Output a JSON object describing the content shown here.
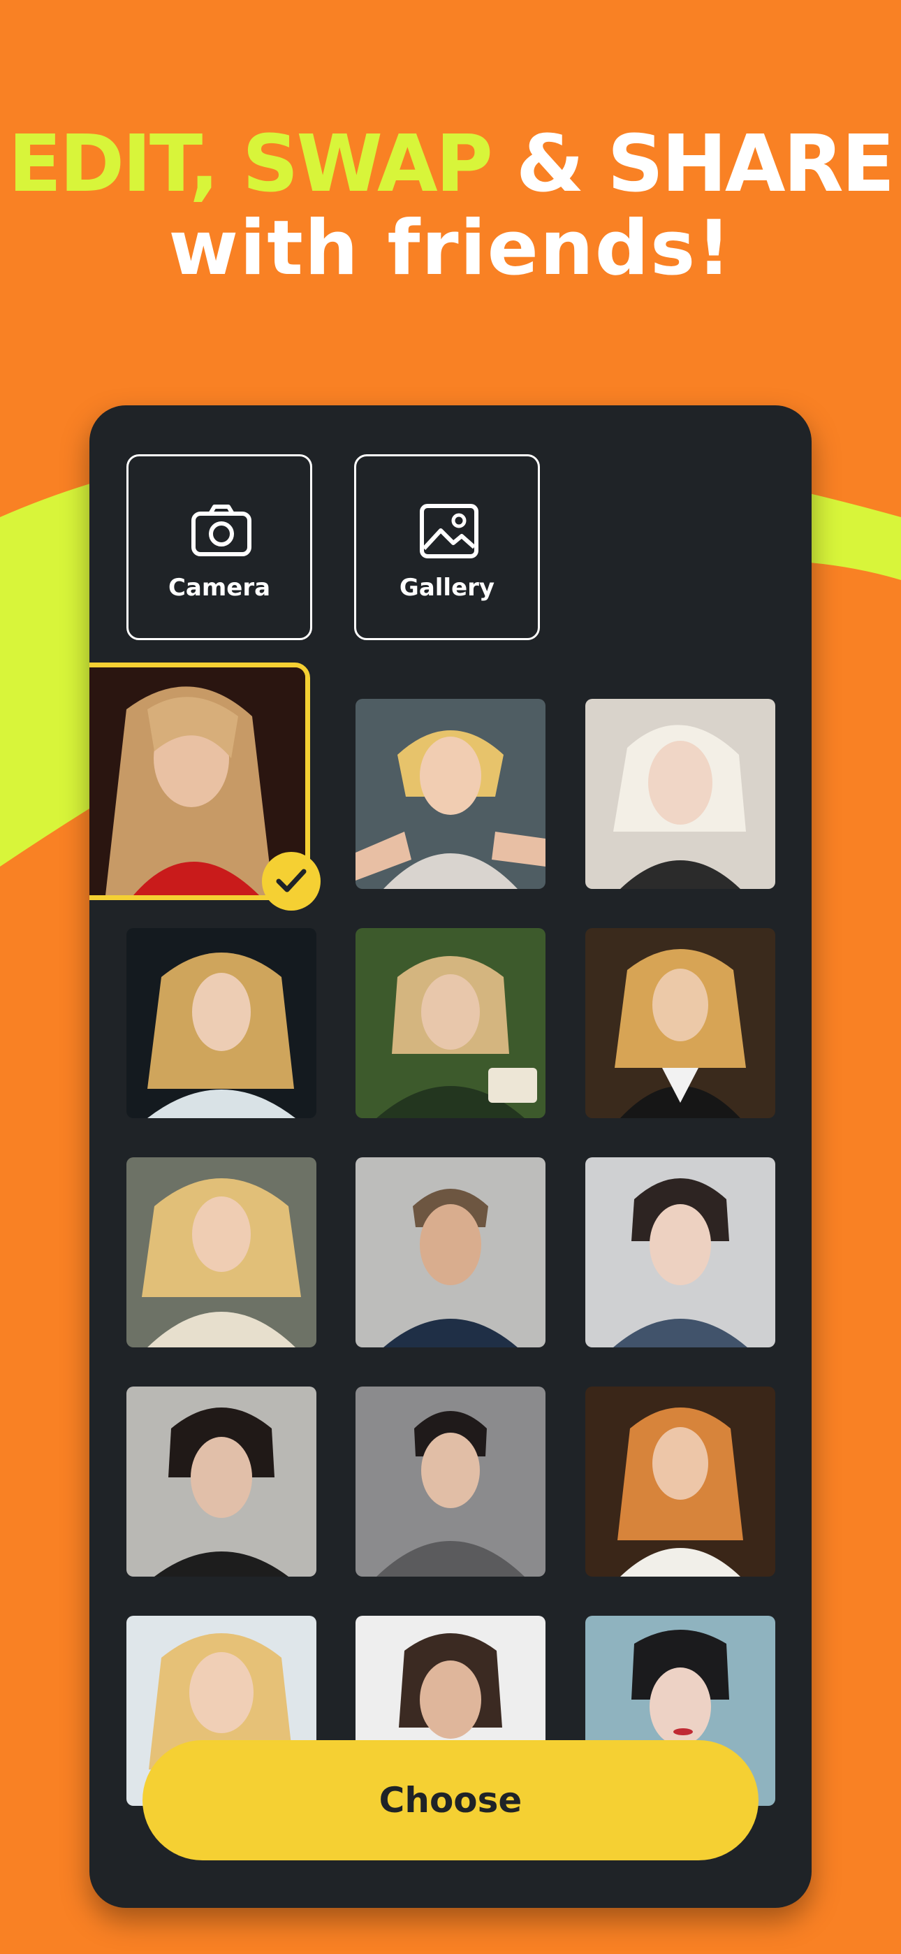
{
  "headline": {
    "part1": "EDIT, SWAP",
    "part2": " & SHARE",
    "line2": "with friends!"
  },
  "colors": {
    "background": "#f98124",
    "accent_lime": "#d8f53a",
    "panel": "#1f2327",
    "accent_yellow": "#f5d033"
  },
  "sources": [
    {
      "label": "Camera",
      "icon": "camera-icon"
    },
    {
      "label": "Gallery",
      "icon": "image-icon"
    }
  ],
  "photos": [
    {
      "id": "portrait-blonde-long-red-top",
      "selected": true
    },
    {
      "id": "portrait-anime-blonde-short",
      "selected": false
    },
    {
      "id": "portrait-platinum-bob",
      "selected": false
    },
    {
      "id": "portrait-blonde-curly",
      "selected": false
    },
    {
      "id": "portrait-blonde-reading",
      "selected": false
    },
    {
      "id": "portrait-blonde-uniform",
      "selected": false
    },
    {
      "id": "portrait-blonde-coat",
      "selected": false
    },
    {
      "id": "portrait-man-navy",
      "selected": false
    },
    {
      "id": "portrait-boy-dark-hair",
      "selected": false
    },
    {
      "id": "portrait-man-black-hair",
      "selected": false
    },
    {
      "id": "portrait-boy-hoodie",
      "selected": false
    },
    {
      "id": "portrait-redhead-uniform",
      "selected": false
    },
    {
      "id": "portrait-smiling-blonde",
      "selected": false
    },
    {
      "id": "portrait-young-man-brown",
      "selected": false
    },
    {
      "id": "portrait-short-dark-hair",
      "selected": false
    }
  ],
  "choose_button": "Choose"
}
